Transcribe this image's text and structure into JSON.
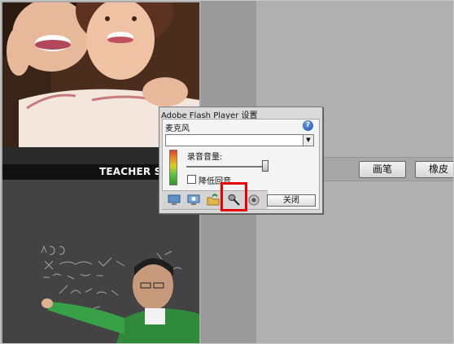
{
  "teacher_label": "TEACHER S",
  "toolbar": {
    "pen_label": "画笔",
    "eraser_label": "橡皮"
  },
  "dialog": {
    "title": "Adobe Flash Player 设置",
    "section_label": "麦克风",
    "help_icon": "?",
    "dropdown_arrow": "▼",
    "volume_label": "录音音量:",
    "checkbox_label": "降低回音",
    "close_label": "关闭",
    "tabs": [
      "privacy-display-icon",
      "local-storage-monitor-icon",
      "storage-folder-icon",
      "microphone-icon",
      "camera-icon"
    ],
    "selected_tab": "microphone-icon"
  },
  "colors": {
    "highlight": "#e60000",
    "help_icon": "#1d4fb4"
  }
}
